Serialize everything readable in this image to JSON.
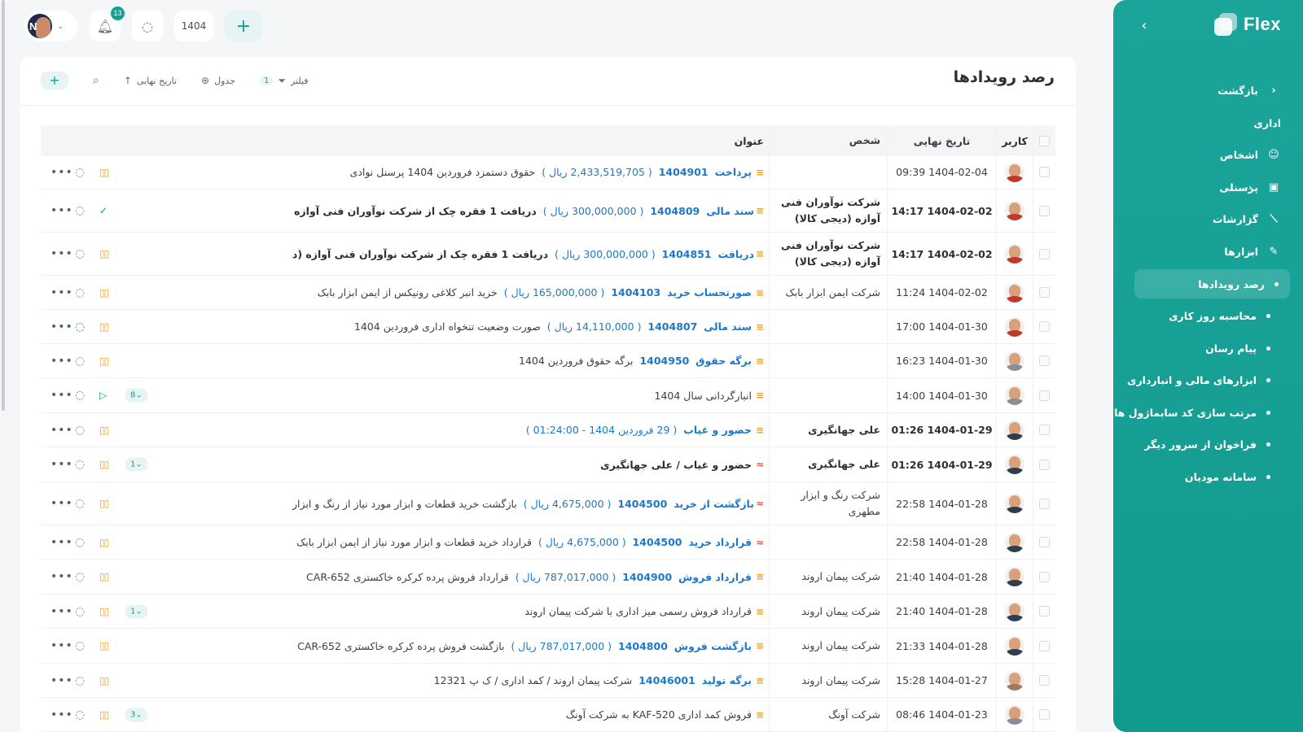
{
  "sidebar": {
    "brand": "Flex",
    "items": [
      {
        "label": "بازگشت",
        "icon": "chevron-left-icon",
        "glyph": "‹",
        "type": "link"
      },
      {
        "label": "اداری",
        "type": "heading"
      },
      {
        "label": "اشخاص",
        "icon": "people-icon",
        "glyph": "☺",
        "type": "item"
      },
      {
        "label": "پرسنلی",
        "icon": "id-card-icon",
        "glyph": "▣",
        "type": "item",
        "caret": "‹"
      },
      {
        "label": "گزارشات",
        "icon": "chart-icon",
        "glyph": "⟋",
        "type": "item",
        "caret": "‹"
      },
      {
        "label": "ابزارها",
        "icon": "pencil-icon",
        "glyph": "✎",
        "type": "item",
        "caret": "⌄"
      },
      {
        "label": "رصد رویدادها",
        "type": "sub",
        "active": true
      },
      {
        "label": "محاسبه روز کاری",
        "type": "sub"
      },
      {
        "label": "پیام رسان",
        "type": "sub"
      },
      {
        "label": "ابزارهای مالی و انبارداری",
        "type": "sub"
      },
      {
        "label": "مرتب سازی کد سابماژول ها",
        "type": "sub"
      },
      {
        "label": "فراخوان از سرور دیگر",
        "type": "sub"
      },
      {
        "label": "سامانه مودیان",
        "type": "sub"
      }
    ]
  },
  "topbar": {
    "avatar_initial": "N",
    "notification_count": "13",
    "year": "1404"
  },
  "page": {
    "title": "رصد رویدادها",
    "tools": {
      "filter_label": "فیلتر",
      "filter_count": "1",
      "view_label": "جدول",
      "sort_label": "تاریخ نهایی"
    }
  },
  "table": {
    "headers": {
      "user": "کاربر",
      "date": "تاریخ نهایی",
      "person": "شخص",
      "title": "عنوان"
    },
    "rows": [
      {
        "date": "1404-02-04 09:39",
        "person": "",
        "prio": "mid",
        "kind": "پرداخت",
        "num": "1404901",
        "amount": "( 2,433,519,705 ریال )",
        "desc": "حقوق دستمزد فروردین 1404 پرسنل نوادی",
        "bold": false,
        "status": "pause",
        "chat": "gray",
        "pill": "",
        "avatar": "#c0392b",
        "h": 42
      },
      {
        "date": "1404-02-02 14:17",
        "person": "شرکت نوآوران فنی آوازه (دیجی کالا)",
        "prio": "mid",
        "kind": "سند مالی",
        "num": "1404809",
        "amount": "( 300,000,000 ریال )",
        "desc": "دریافت 1 فقره چک از شرکت نوآوران فنی آوازه (دیجی کالا)",
        "bold": true,
        "status": "done",
        "chat": "gray",
        "pill": "",
        "avatar": "#c0392b",
        "h": 53
      },
      {
        "date": "1404-02-02 14:17",
        "person": "شرکت نوآوران فنی آوازه (دیجی کالا)",
        "prio": "mid",
        "kind": "دریافت",
        "num": "1404851",
        "amount": "( 300,000,000 ریال )",
        "desc": "دریافت 1 فقره چک از شرکت نوآوران فنی آوازه (دیجی کالا)",
        "bold": true,
        "status": "pause",
        "chat": "gray",
        "pill": "",
        "avatar": "#c0392b",
        "h": 53
      },
      {
        "date": "1404-02-02 11:24",
        "person": "شرکت ایمن ابزار بابک",
        "prio": "mid",
        "kind": "صورتحساب خرید",
        "num": "1404103",
        "amount": "( 165,000,000 ریال )",
        "desc": "خرید انبر کلاغی رونیکس از ایمن ابزار بابک",
        "bold": false,
        "status": "pause",
        "chat": "gray",
        "pill": "",
        "avatar": "#c0392b",
        "h": 42
      },
      {
        "date": "1404-01-30 17:00",
        "person": "",
        "prio": "mid",
        "kind": "سند مالی",
        "num": "1404807",
        "amount": "( 14,110,000 ریال )",
        "desc": "صورت وضعیت تنخواه اداری فروردین 1404",
        "bold": false,
        "status": "pause",
        "chat": "green",
        "pill": "",
        "avatar": "#c0392b",
        "h": 42
      },
      {
        "date": "1404-01-30 16:23",
        "person": "",
        "prio": "mid",
        "kind": "برگه حقوق",
        "num": "1404950",
        "amount": "",
        "desc": "برگه حقوق فروردین 1404",
        "bold": false,
        "status": "pause",
        "chat": "gray",
        "pill": "",
        "avatar": "#8a8f96",
        "h": 42
      },
      {
        "date": "1404-01-30 14:00",
        "person": "",
        "prio": "mid",
        "kind": "",
        "num": "",
        "amount": "",
        "desc": "انبارگردانی سال 1404",
        "bold": false,
        "status": "play",
        "chat": "gray",
        "pill": "8⌄",
        "avatar": "#8a8f96",
        "h": 43
      },
      {
        "date": "1404-01-29 01:26",
        "person": "علی جهانگیری",
        "prio": "mid",
        "kind": "حضور و غیاب",
        "num": "",
        "amount": "( 29 فروردین 1404 - 01:24:00 )",
        "desc": "",
        "bold": true,
        "status": "pause",
        "chat": "gray",
        "pill": "",
        "avatar": "#2c3e50",
        "h": 42
      },
      {
        "date": "1404-01-29 01:26",
        "person": "علی جهانگیری",
        "prio": "high",
        "kind": "",
        "num": "",
        "amount": "",
        "desc": "حضور و غیاب / علی جهانگیری",
        "bold": true,
        "status": "pause",
        "chat": "gray",
        "pill": "1⌄",
        "avatar": "#2c3e50",
        "h": 43
      },
      {
        "date": "1404-01-28 22:58",
        "person": "شرکت رنگ و ابزار مطهری",
        "prio": "high",
        "kind": "بازگشت از خرید",
        "num": "1404500",
        "amount": "( 4,675,000 ریال )",
        "desc": "بازگشت خرید قطعات و ابزار مورد نیاز از رنگ و ابزار مطهری",
        "bold": false,
        "status": "pause",
        "chat": "gray",
        "pill": "",
        "avatar": "#2c3e50",
        "h": 53
      },
      {
        "date": "1404-01-28 22:58",
        "person": "",
        "prio": "high",
        "kind": "قرارداد خرید",
        "num": "1404500",
        "amount": "( 4,675,000 ریال )",
        "desc": "قرارداد خرید قطعات و ابزار مورد نیاز از ایمن ابزار بابک",
        "bold": false,
        "status": "pause",
        "chat": "gray",
        "pill": "",
        "avatar": "#2c3e50",
        "h": 42
      },
      {
        "date": "1404-01-28 21:40",
        "person": "شرکت پیمان اروند",
        "prio": "mid",
        "kind": "قرارداد فروش",
        "num": "1404900",
        "amount": "( 787,017,000 ریال )",
        "desc": "قرارداد فروش پرده کرکره خاکستری CAR-652",
        "bold": false,
        "status": "pause",
        "chat": "gray",
        "pill": "",
        "avatar": "#2c3e50",
        "h": 43
      },
      {
        "date": "1404-01-28 21:40",
        "person": "شرکت پیمان اروند",
        "prio": "mid",
        "kind": "",
        "num": "",
        "amount": "",
        "desc": "قرارداد فروش رسمی میز اداری با شرکت پیمان اروند",
        "bold": false,
        "status": "pause",
        "chat": "gray",
        "pill": "1⌄",
        "avatar": "#2c3e50",
        "h": 42
      },
      {
        "date": "1404-01-28 21:33",
        "person": "شرکت پیمان اروند",
        "prio": "mid",
        "kind": "بازگشت فروش",
        "num": "1404800",
        "amount": "( 787,017,000 ریال )",
        "desc": "بازگشت فروش پرده کرکره خاکستری CAR-652",
        "bold": false,
        "status": "pause",
        "chat": "gray",
        "pill": "",
        "avatar": "#2c3e50",
        "h": 43
      },
      {
        "date": "1404-01-27 15:28",
        "person": "شرکت پیمان اروند",
        "prio": "mid",
        "kind": "برگه تولید",
        "num": "14046001",
        "amount": "",
        "desc": "شرکت پیمان اروند / کمد اداری / ک پ 12321",
        "bold": false,
        "status": "pause",
        "chat": "gray",
        "pill": "",
        "avatar": "#a07a5a",
        "h": 42
      },
      {
        "date": "1404-01-23 08:46",
        "person": "شرکت آونگ",
        "prio": "mid",
        "kind": "",
        "num": "",
        "amount": "",
        "desc": "فروش کمد اداری KAF-520 به شرکت آونگ",
        "bold": false,
        "status": "pause",
        "chat": "gray",
        "pill": "3⌄",
        "avatar": "#8a8f96",
        "h": 42
      }
    ]
  },
  "colors": {
    "accent": "#14a093",
    "link": "#1d78c9",
    "priority_mid": "#f2a31b",
    "priority_high": "#ef5a4a",
    "done": "#1aa34a"
  },
  "icons": {
    "more": "more-dots-icon",
    "chat": "chat-bubble-icon",
    "pause": "pause-icon",
    "done": "check-icon",
    "play": "play-icon",
    "search": "search-icon",
    "filter": "filter-icon",
    "view": "grid-icon",
    "sort": "arrow-up-icon",
    "bell": "bell-icon",
    "add": "plus-icon"
  }
}
